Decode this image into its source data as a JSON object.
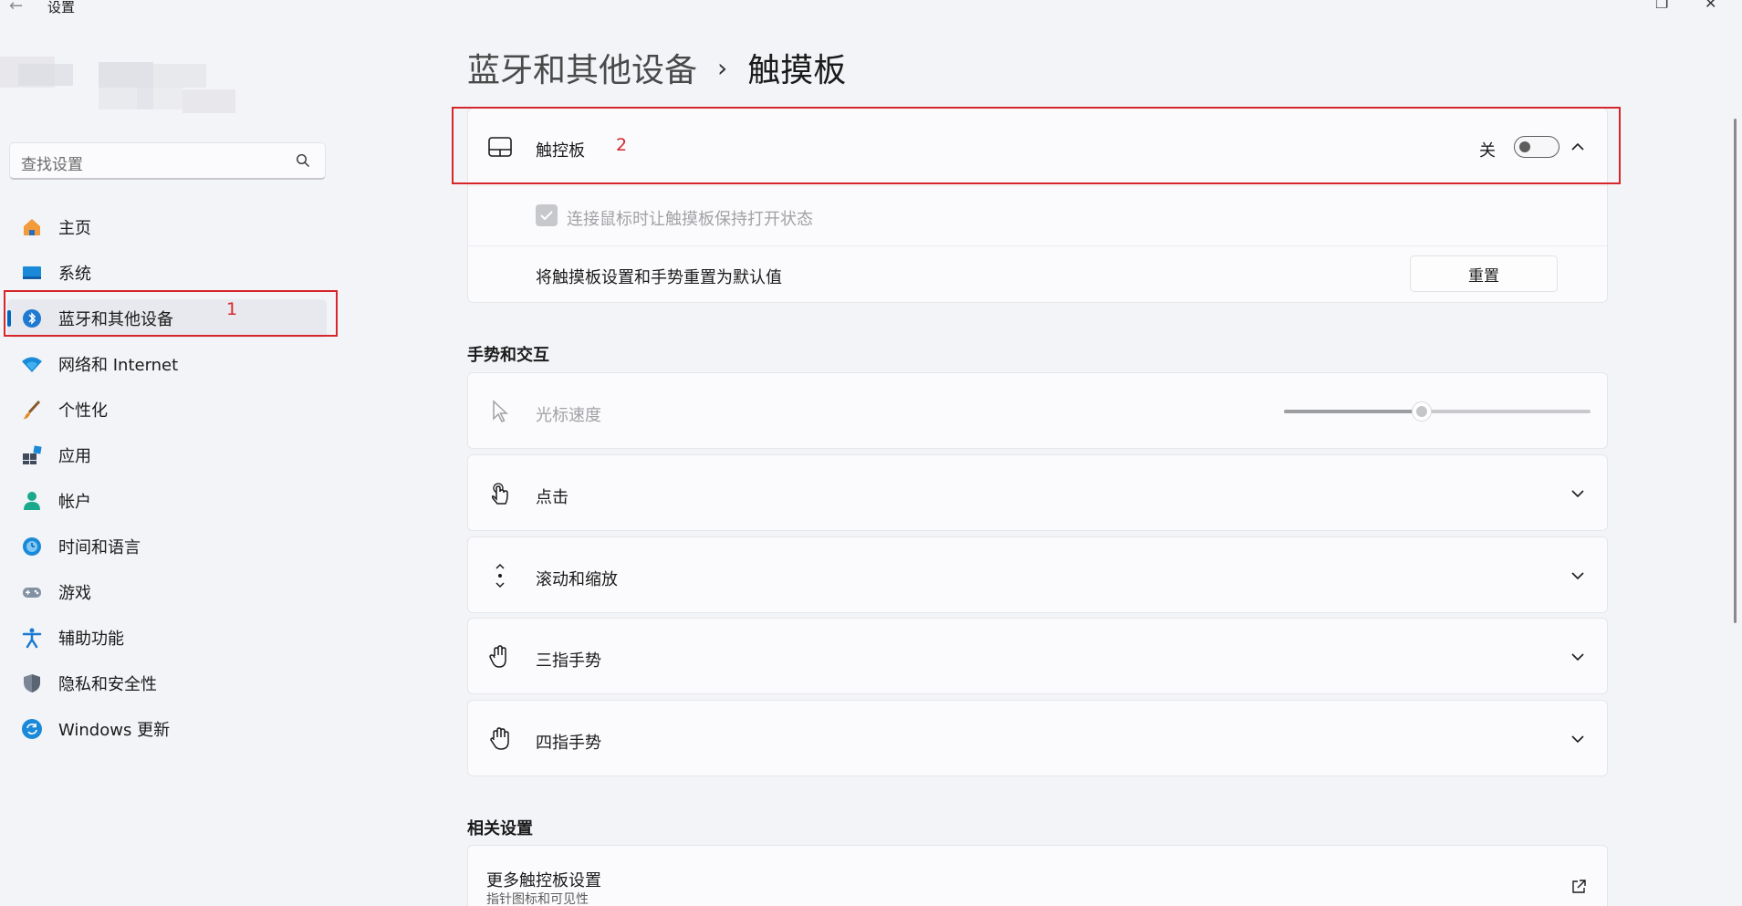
{
  "window": {
    "title": "设置",
    "back_glyph": "←",
    "restore_glyph": "❐",
    "close_glyph": "✕"
  },
  "sidebar": {
    "search_placeholder": "查找设置",
    "items": [
      {
        "label": "主页",
        "icon": "home-icon"
      },
      {
        "label": "系统",
        "icon": "system-icon"
      },
      {
        "label": "蓝牙和其他设备",
        "icon": "bluetooth-icon",
        "active": true
      },
      {
        "label": "网络和 Internet",
        "icon": "wifi-icon"
      },
      {
        "label": "个性化",
        "icon": "brush-icon"
      },
      {
        "label": "应用",
        "icon": "apps-icon"
      },
      {
        "label": "帐户",
        "icon": "account-icon"
      },
      {
        "label": "时间和语言",
        "icon": "globe-clock-icon"
      },
      {
        "label": "游戏",
        "icon": "gamepad-icon"
      },
      {
        "label": "辅助功能",
        "icon": "accessibility-icon"
      },
      {
        "label": "隐私和安全性",
        "icon": "shield-icon"
      },
      {
        "label": "Windows 更新",
        "icon": "update-icon"
      }
    ]
  },
  "annotations": {
    "one": "1",
    "two": "2"
  },
  "breadcrumb": {
    "parent": "蓝牙和其他设备",
    "separator": "›",
    "current": "触摸板"
  },
  "touchpad": {
    "label": "触控板",
    "state_label": "关",
    "enabled": false,
    "keep_on_label": "连接鼠标时让触摸板保持打开状态",
    "reset_label": "将触摸板设置和手势重置为默认值",
    "reset_button": "重置"
  },
  "gestures": {
    "section_title": "手势和交互",
    "cursor_speed_label": "光标速度",
    "cursor_speed_value": 0.45,
    "tap_label": "点击",
    "scroll_label": "滚动和缩放",
    "three_finger_label": "三指手势",
    "four_finger_label": "四指手势"
  },
  "related": {
    "section_title": "相关设置",
    "more_label": "更多触控板设置",
    "more_sub": "指针图标和可见性"
  },
  "colors": {
    "accent": "#0067c0",
    "annotation_red": "#d6262b"
  }
}
